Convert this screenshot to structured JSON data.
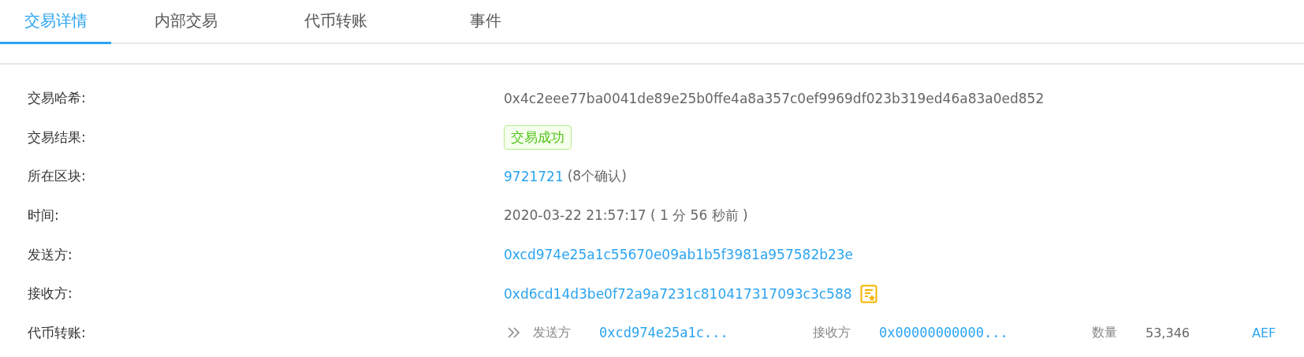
{
  "tabs": [
    {
      "label": "交易详情",
      "selected": true
    },
    {
      "label": "内部交易",
      "selected": false
    },
    {
      "label": "代币转账",
      "selected": false
    },
    {
      "label": "事件",
      "selected": false
    }
  ],
  "rows": [
    {
      "kind": "text",
      "label": "交易哈希:",
      "value": "0x4c2eee77ba0041de89e25b0ffe4a8a357c0ef9969df023b319ed46a83a0ed852"
    },
    {
      "kind": "badge",
      "label": "交易结果:",
      "value": "交易成功"
    },
    {
      "kind": "block",
      "label": "所在区块:",
      "value": "9721721",
      "note": "(8个确认)"
    },
    {
      "kind": "text",
      "label": "时间:",
      "value": "2020-03-22 21:57:17 ( 1 分 56 秒前 )"
    },
    {
      "kind": "link",
      "label": "发送方:",
      "value": "0xcd974e25a1c55670e09ab1b5f3981a957582b23e"
    },
    {
      "kind": "contract",
      "label": "接收方:",
      "value": "0xd6cd14d3be0f72a9a7231c810417317093c3c588"
    },
    {
      "kind": "transfer",
      "label": "代币转账:",
      "from_label": "发送方",
      "from": "0xcd974e25a1c...",
      "to_label": "接收方",
      "to": "0x00000000000...",
      "amount_label": "数量",
      "amount": "53,346",
      "token": "AEF"
    }
  ]
}
